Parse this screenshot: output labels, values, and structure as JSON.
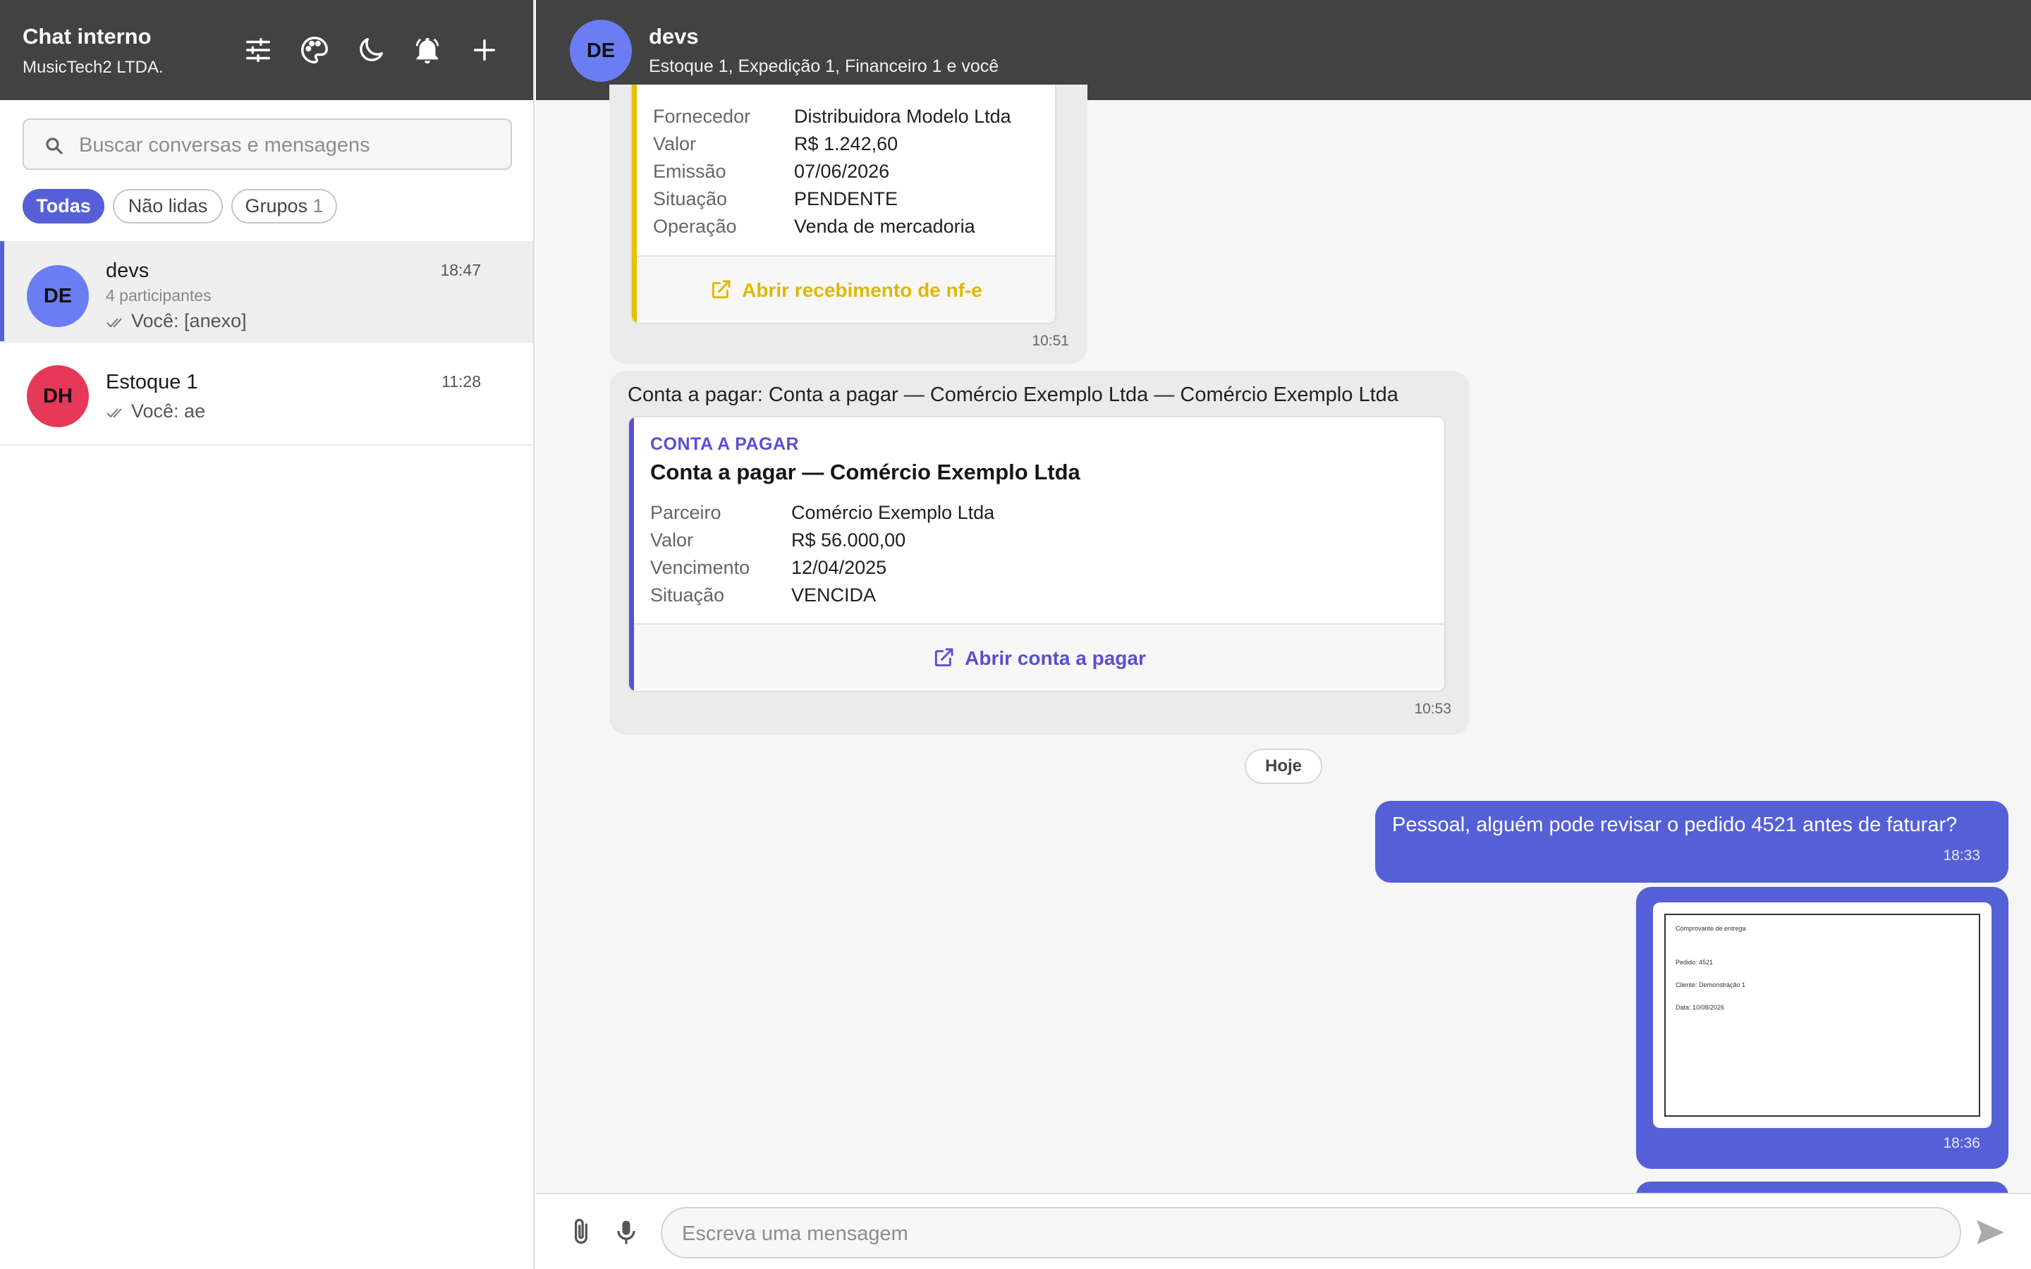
{
  "sidebar": {
    "title": "Chat interno",
    "subtitle": "MusicTech2 LTDA.",
    "header_icons": [
      "sliders-icon",
      "palette-icon",
      "moon-icon",
      "bell-icon",
      "plus-icon"
    ],
    "search": {
      "placeholder": "Buscar conversas e mensagens",
      "value": ""
    },
    "filters": [
      {
        "label": "Todas",
        "active": true
      },
      {
        "label": "Não lidas",
        "active": false
      },
      {
        "label": "Grupos",
        "count": "1",
        "active": false
      }
    ],
    "conversations": [
      {
        "initials": "DE",
        "name": "devs",
        "time": "18:47",
        "participants": "4 participantes",
        "last": "Você: [anexo]",
        "avatar_color": "#6b7df2",
        "selected": true
      },
      {
        "initials": "DH",
        "name": "Estoque 1",
        "time": "11:28",
        "last": "Você: ae",
        "avatar_color": "#e6395a",
        "selected": false
      }
    ]
  },
  "chat": {
    "initials": "DE",
    "name": "devs",
    "members": "Estoque 1, Expedição 1, Financeiro 1 e você",
    "card_nfe": {
      "rows": [
        {
          "key": "Fornecedor",
          "value": "Distribuidora Modelo Ltda"
        },
        {
          "key": "Valor",
          "value": "R$ 1.242,60"
        },
        {
          "key": "Emissão",
          "value": "07/06/2026"
        },
        {
          "key": "Situação",
          "value": "PENDENTE"
        },
        {
          "key": "Operação",
          "value": "Venda de mercadoria"
        }
      ],
      "action": "Abrir recebimento de nf-e",
      "accent": "#e8c100",
      "time": "10:51"
    },
    "card_pagar": {
      "text": "Conta a pagar: Conta a pagar — Comércio Exemplo Ltda — Comércio Exemplo Ltda",
      "kind": "CONTA A PAGAR",
      "title": "Conta a pagar — Comércio Exemplo Ltda",
      "rows": [
        {
          "key": "Parceiro",
          "value": "Comércio Exemplo Ltda"
        },
        {
          "key": "Valor",
          "value": "R$ 56.000,00"
        },
        {
          "key": "Vencimento",
          "value": "12/04/2025"
        },
        {
          "key": "Situação",
          "value": "VENCIDA"
        }
      ],
      "action": "Abrir conta a pagar",
      "accent": "#5a4fd3",
      "time": "10:53"
    },
    "day_separator": "Hoje",
    "outgoing": [
      {
        "text": "Pessoal, alguém pode revisar o pedido 4521 antes de faturar?",
        "time": "18:33"
      },
      {
        "attachment": {
          "title": "Comprovante de entrega",
          "lines": [
            "Pedido: 4521",
            "Cliente: Demonstração 1",
            "Data: 10/08/2026"
          ]
        },
        "time": "18:36"
      }
    ],
    "composer": {
      "placeholder": "Escreva uma mensagem",
      "icons": [
        "paperclip-icon",
        "microphone-icon",
        "send-icon"
      ]
    }
  },
  "colors": {
    "header": "#424242",
    "accent": "#5560d6",
    "nfe_accent": "#e8c100",
    "pagar_accent": "#5a4fd3"
  }
}
